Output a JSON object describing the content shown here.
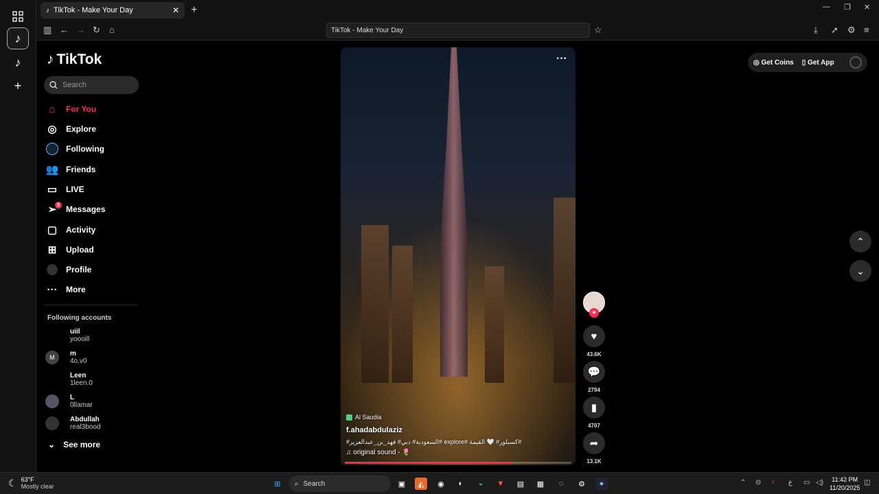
{
  "browser": {
    "tab_title": "TikTok - Make Your Day",
    "url_text": "TikTok - Make Your Day"
  },
  "sidebar": {
    "logo": "TikTok",
    "search_placeholder": "Search",
    "nav": [
      {
        "label": "For You",
        "icon": "home-icon"
      },
      {
        "label": "Explore",
        "icon": "compass-icon"
      },
      {
        "label": "Following",
        "icon": "following-icon"
      },
      {
        "label": "Friends",
        "icon": "friends-icon"
      },
      {
        "label": "LIVE",
        "icon": "live-icon"
      },
      {
        "label": "Messages",
        "icon": "messages-icon",
        "badge": "3"
      },
      {
        "label": "Activity",
        "icon": "activity-icon"
      },
      {
        "label": "Upload",
        "icon": "upload-icon"
      },
      {
        "label": "Profile",
        "icon": "profile-icon"
      },
      {
        "label": "More",
        "icon": "more-icon"
      }
    ],
    "following_title": "Following accounts",
    "accounts": [
      {
        "name": "uiil",
        "handle": "yoooill",
        "avatar": ""
      },
      {
        "name": "m",
        "handle": "4o.v0",
        "avatar": "M"
      },
      {
        "name": "Leen",
        "handle": "1leen.0",
        "avatar": ""
      },
      {
        "name": "L",
        "handle": "0llamar",
        "avatar": ""
      },
      {
        "name": "Abdullah",
        "handle": "real3bood",
        "avatar": ""
      }
    ],
    "see_more": "See more"
  },
  "video": {
    "location": "Al Saudia",
    "username": "f.ahadabdulaziz",
    "tags": "#السعودية# دبي# فهد_بن_عبدالعزيز# explore# كسبلور# 🤍 القيمة#",
    "sound": "♫ original sound - 🌷",
    "progress": 0.74
  },
  "actions": {
    "likes": "43.6K",
    "comments": "2794",
    "saves": "4707",
    "shares": "13.1K"
  },
  "top_right": {
    "get_coins": "Get Coins",
    "get_app": "Get App"
  },
  "taskbar": {
    "temp": "63°F",
    "condition": "Mostly clear",
    "search": "Search",
    "time": "11:42 PM",
    "date": "11/20/2025"
  },
  "colors": {
    "accent": "#fe2c55",
    "background": "#000000"
  }
}
